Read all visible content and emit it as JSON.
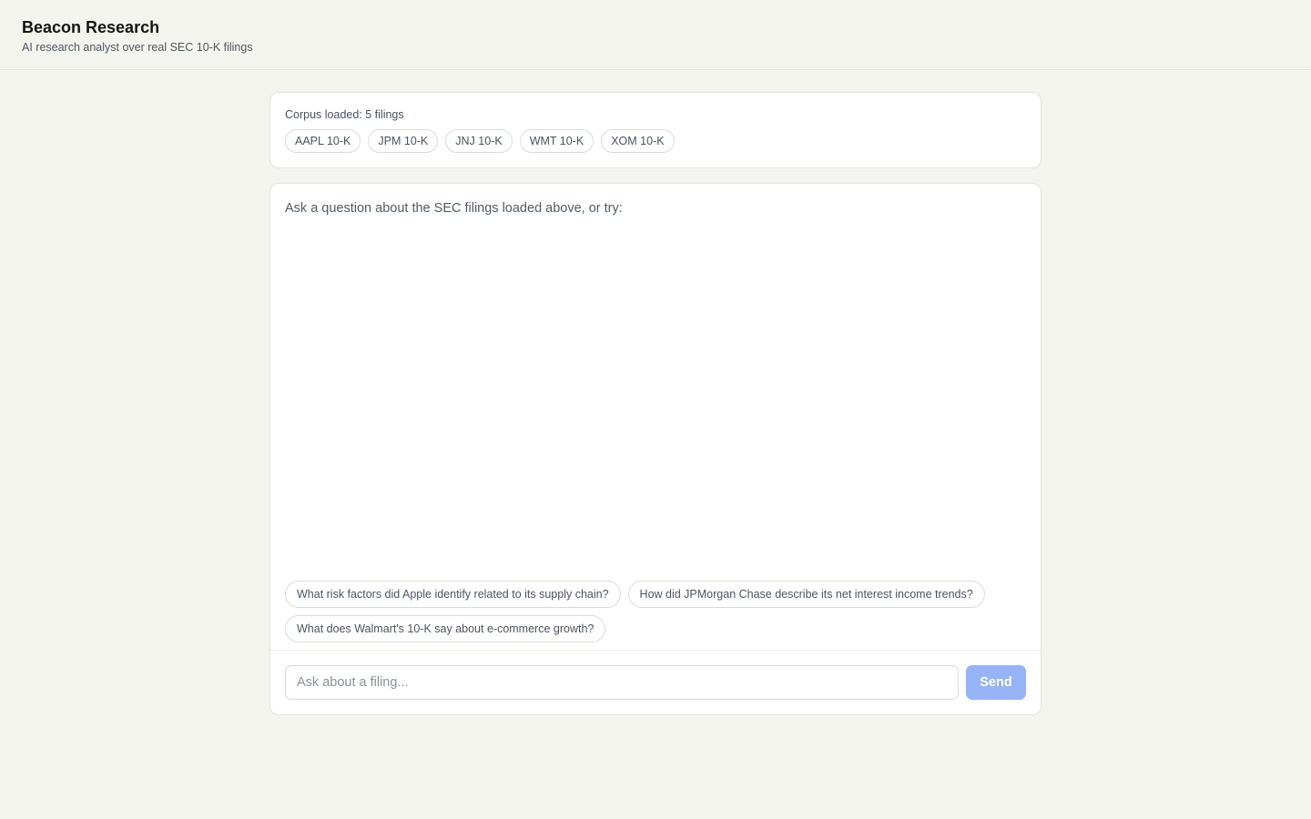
{
  "header": {
    "title": "Beacon Research",
    "subtitle": "AI research analyst over real SEC 10-K filings"
  },
  "corpus": {
    "label": "Corpus loaded: 5 filings",
    "filings": [
      "AAPL 10-K",
      "JPM 10-K",
      "JNJ 10-K",
      "WMT 10-K",
      "XOM 10-K"
    ]
  },
  "chat": {
    "intro": "Ask a question about the SEC filings loaded above, or try:",
    "suggestions": [
      "What risk factors did Apple identify related to its supply chain?",
      "How did JPMorgan Chase describe its net interest income trends?",
      "What does Walmart's 10-K say about e-commerce growth?"
    ]
  },
  "composer": {
    "input_value": "",
    "input_placeholder": "Ask about a filing...",
    "send_label": "Send"
  },
  "colors": {
    "background": "#f4f4ef",
    "card": "#ffffff",
    "send_button_disabled": "#95b3f5"
  }
}
